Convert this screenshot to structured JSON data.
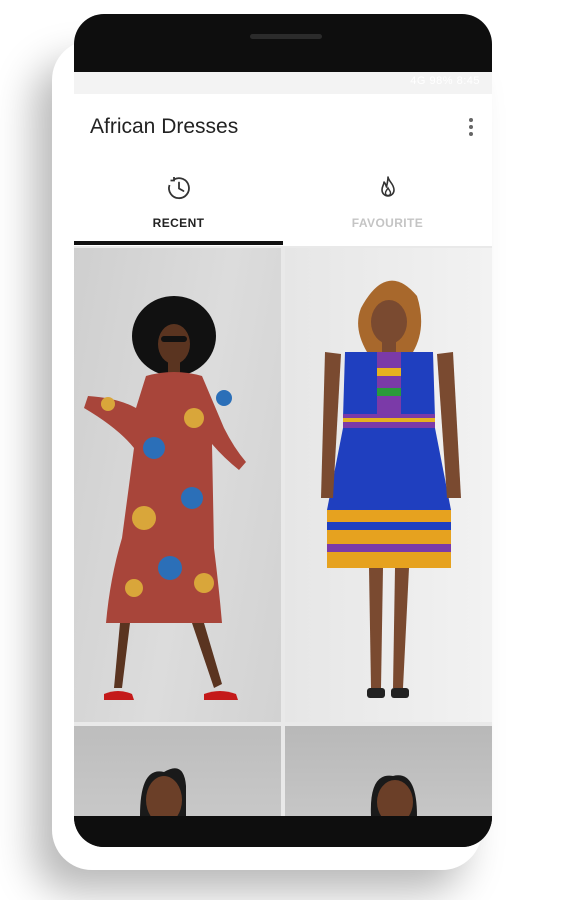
{
  "status_bar": {
    "text": "4G 98% 8:45"
  },
  "app_bar": {
    "title": "African Dresses",
    "menu_icon": "more-vertical-icon"
  },
  "tabs": [
    {
      "label": "RECENT",
      "icon": "history-icon",
      "selected": true
    },
    {
      "label": "FAVOURITE",
      "icon": "flame-icon",
      "selected": false
    }
  ],
  "gallery": {
    "items": [
      {
        "description": "Woman in floral print wrap dress with wide black hat"
      },
      {
        "description": "Woman in blue dress with kente pattern hem"
      },
      {
        "description": "Portrait of woman"
      },
      {
        "description": "Portrait of woman"
      }
    ]
  },
  "colors": {
    "tab_indicator": "#111111",
    "inactive_tab": "#c4c4c4"
  }
}
